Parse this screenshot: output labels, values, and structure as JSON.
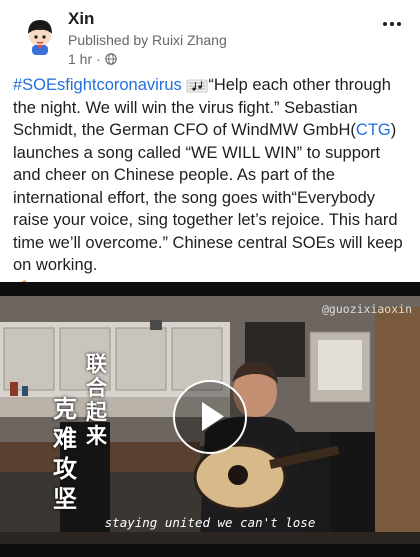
{
  "post": {
    "author": "Xin",
    "published_by": "Published by Ruixi Zhang",
    "time": "1 hr",
    "time_separator": "·",
    "text": {
      "hashtag": "#SOEsfightcoronavirus",
      "part1": "“Help each other through the night. We will win the virus fight.” Sebastian Schmidt, the German CFO of WindMW GmbH(",
      "link": "CTG",
      "part2": ") launches a song called “WE WILL WIN” to support and cheer on Chinese people. As part of the international effort, the song goes with“Everybody raise your voice, sing together let’s rejoice. This hard time we’ll overcome.” Chinese central SOEs will keep on working."
    }
  },
  "video": {
    "watermark": "@guozixiaoxin",
    "caption": "staying united we can't lose",
    "overlay_col1": "联合起来",
    "overlay_col2": "克难攻坚"
  },
  "icons": {
    "music": "music-notes-icon",
    "muscle": "flexed-biceps-icon",
    "globe": "globe-icon",
    "more": "more-options-icon",
    "play": "play-icon"
  },
  "colors": {
    "link": "#216fdb",
    "text": "#1c1e21",
    "secondary": "#65676b"
  }
}
